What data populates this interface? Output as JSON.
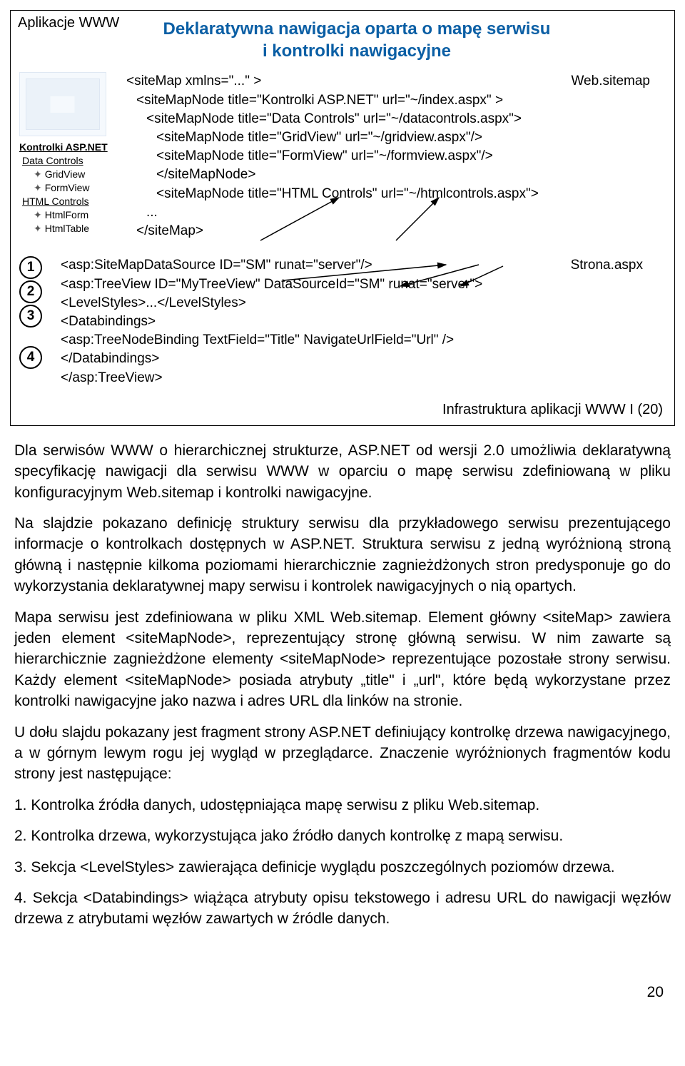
{
  "header": "Aplikacje WWW",
  "title": "Deklaratywna nawigacja oparta o mapę serwisu\ni kontrolki nawigacyjne",
  "tree": {
    "root_label": "Kontrolki ASP.NET",
    "group1": "Data Controls",
    "g1_items": [
      "GridView",
      "FormView"
    ],
    "group2": "HTML Controls",
    "g2_items": [
      "HtmlForm",
      "HtmlTable"
    ]
  },
  "code1": {
    "file": "Web.sitemap",
    "l1": "<siteMap xmlns=\"...\" >",
    "l2": "<siteMapNode title=\"Kontrolki ASP.NET\" url=\"~/index.aspx\" >",
    "l3": "<siteMapNode title=\"Data Controls\" url=\"~/datacontrols.aspx\">",
    "l4": "<siteMapNode title=\"GridView\" url=\"~/gridview.aspx\"/>",
    "l5": "<siteMapNode title=\"FormView\" url=\"~/formview.aspx\"/>",
    "l6": "</siteMapNode>",
    "l7": "<siteMapNode title=\"HTML Controls\" url=\"~/htmlcontrols.aspx\">",
    "l8": "...",
    "l9": "</siteMap>"
  },
  "circles": [
    "1",
    "2",
    "3",
    "4"
  ],
  "code2": {
    "file": "Strona.aspx",
    "l1": "<asp:SiteMapDataSource ID=\"SM\" runat=\"server\"/>",
    "l2": "<asp:TreeView ID=\"MyTreeView\" DataSourceId=\"SM\" runat=\"server\">",
    "l3": "<LevelStyles>...</LevelStyles>",
    "l4": "<Databindings>",
    "l5": "<asp:TreeNodeBinding TextField=\"Title\" NavigateUrlField=\"Url\" />",
    "l6": "</Databindings>",
    "l7": "</asp:TreeView>"
  },
  "footer": "Infrastruktura aplikacji WWW I (20)",
  "notes": {
    "p1": "Dla serwisów WWW o hierarchicznej strukturze, ASP.NET od wersji 2.0 umożliwia deklaratywną specyfikację nawigacji dla serwisu WWW w oparciu o mapę serwisu zdefiniowaną w pliku konfiguracyjnym Web.sitemap i kontrolki nawigacyjne.",
    "p2": "Na slajdzie pokazano definicję struktury serwisu dla przykładowego serwisu prezentującego informacje o kontrolkach dostępnych w ASP.NET. Struktura serwisu z jedną wyróżnioną stroną główną i następnie kilkoma poziomami hierarchicznie zagnieżdżonych stron predysponuje go do wykorzystania deklaratywnej mapy serwisu i kontrolek nawigacyjnych o nią opartych.",
    "p3": "Mapa serwisu jest zdefiniowana w pliku XML Web.sitemap. Element główny <siteMap> zawiera jeden element <siteMapNode>, reprezentujący stronę główną serwisu. W nim zawarte są hierarchicznie zagnieżdżone elementy <siteMapNode> reprezentujące pozostałe strony serwisu. Każdy element <siteMapNode> posiada atrybuty „title\" i „url\", które będą wykorzystane przez kontrolki nawigacyjne jako nazwa i adres URL dla linków na stronie.",
    "p4": "U dołu slajdu pokazany jest fragment strony ASP.NET definiujący kontrolkę drzewa nawigacyjnego, a w górnym lewym rogu jej wygląd w przeglądarce. Znaczenie wyróżnionych fragmentów kodu strony jest następujące:",
    "p5": "1. Kontrolka źródła danych, udostępniająca mapę serwisu z pliku Web.sitemap.",
    "p6": "2. Kontrolka drzewa, wykorzystująca jako źródło danych kontrolkę z mapą serwisu.",
    "p7": "3. Sekcja <LevelStyles> zawierająca definicje wyglądu poszczególnych poziomów drzewa.",
    "p8": "4. Sekcja <Databindings> wiążąca atrybuty opisu tekstowego i adresu URL do nawigacji węzłów drzewa z atrybutami węzłów zawartych w źródle danych."
  },
  "pageno": "20"
}
